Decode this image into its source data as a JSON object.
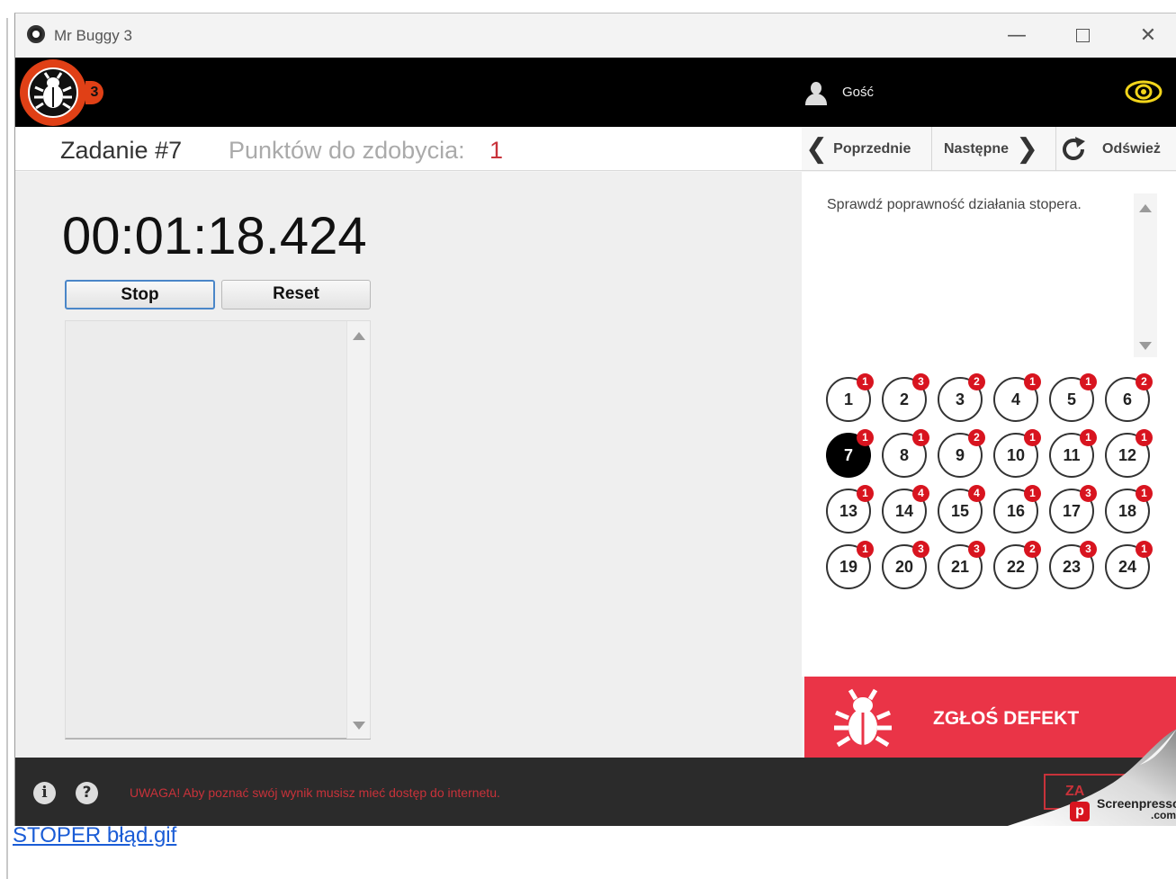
{
  "window": {
    "title": "Mr Buggy 3",
    "minimize": "—",
    "close": "✕"
  },
  "header": {
    "logo_number": "3",
    "user_name": "Gość"
  },
  "task": {
    "title": "Zadanie #7",
    "points_label": "Punktów do zdobycia:",
    "points_value": "1"
  },
  "nav": {
    "prev_label": "Poprzednie",
    "next_label": "Następne",
    "refresh_label": "Odśwież"
  },
  "stopwatch": {
    "time": "00:01:18.424",
    "stop_label": "Stop",
    "reset_label": "Reset"
  },
  "description": "Sprawdź poprawność działania stopera.",
  "tasks": [
    {
      "n": "1",
      "badge": "1",
      "active": false
    },
    {
      "n": "2",
      "badge": "3",
      "active": false
    },
    {
      "n": "3",
      "badge": "2",
      "active": false
    },
    {
      "n": "4",
      "badge": "1",
      "active": false
    },
    {
      "n": "5",
      "badge": "1",
      "active": false
    },
    {
      "n": "6",
      "badge": "2",
      "active": false
    },
    {
      "n": "7",
      "badge": "1",
      "active": true
    },
    {
      "n": "8",
      "badge": "1",
      "active": false
    },
    {
      "n": "9",
      "badge": "2",
      "active": false
    },
    {
      "n": "10",
      "badge": "1",
      "active": false
    },
    {
      "n": "11",
      "badge": "1",
      "active": false
    },
    {
      "n": "12",
      "badge": "1",
      "active": false
    },
    {
      "n": "13",
      "badge": "1",
      "active": false
    },
    {
      "n": "14",
      "badge": "4",
      "active": false
    },
    {
      "n": "15",
      "badge": "4",
      "active": false
    },
    {
      "n": "16",
      "badge": "1",
      "active": false
    },
    {
      "n": "17",
      "badge": "3",
      "active": false
    },
    {
      "n": "18",
      "badge": "1",
      "active": false
    },
    {
      "n": "19",
      "badge": "1",
      "active": false
    },
    {
      "n": "20",
      "badge": "3",
      "active": false
    },
    {
      "n": "21",
      "badge": "3",
      "active": false
    },
    {
      "n": "22",
      "badge": "2",
      "active": false
    },
    {
      "n": "23",
      "badge": "3",
      "active": false
    },
    {
      "n": "24",
      "badge": "1",
      "active": false
    }
  ],
  "report": {
    "label": "ZGŁOŚ DEFEKT"
  },
  "footer": {
    "info_icon": "i",
    "help_icon": "?",
    "warning": "UWAGA! Aby poznać swój wynik musisz mieć dostęp do internetu.",
    "button_label": "ZA"
  },
  "watermark": {
    "logo_letter": "p",
    "text": "Screenpresso",
    "text2": ".com"
  },
  "caption": "STOPER błąd.gif",
  "colors": {
    "accent_red": "#ea3447",
    "logo_orange": "#e04016",
    "badge_red": "#d8141f",
    "header_black": "#000000",
    "eye_yellow": "#f2d51b"
  }
}
